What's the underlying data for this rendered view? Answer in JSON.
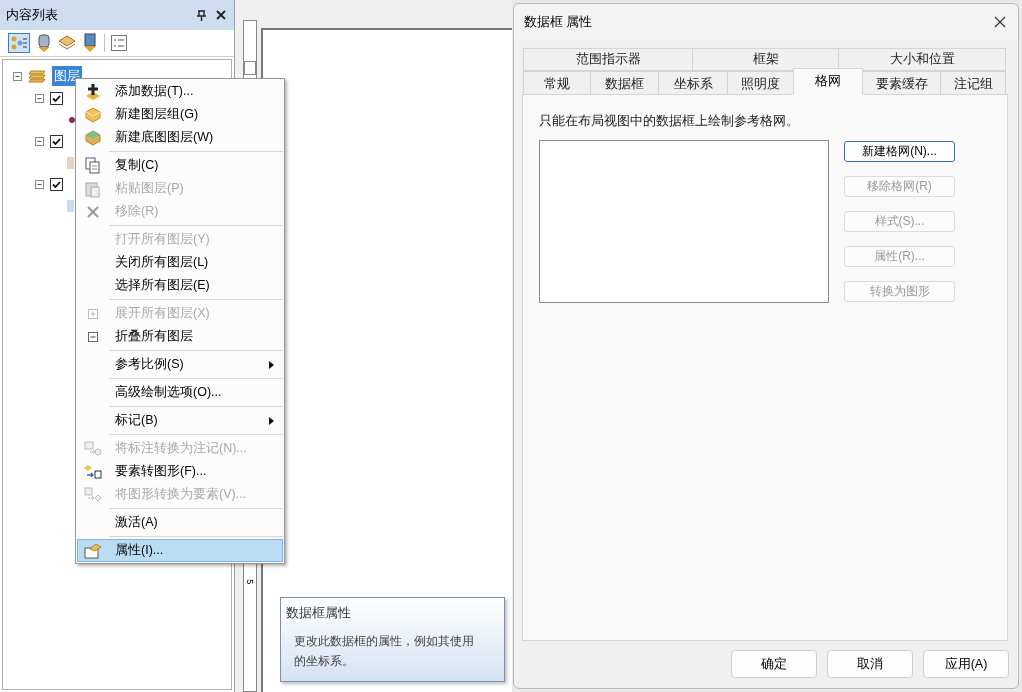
{
  "toc": {
    "title": "内容列表",
    "root": {
      "label": "图层",
      "selected": true,
      "expanded": true
    },
    "layers": [
      {
        "checked": true,
        "expanded": true,
        "color": "#8b2d4a"
      },
      {
        "checked": true,
        "expanded": true,
        "color": "#e9cfc0"
      },
      {
        "checked": true,
        "expanded": true,
        "color": "#c6dcef"
      }
    ]
  },
  "layout_view": {
    "ruler_label": "5"
  },
  "context_menu": [
    {
      "kind": "item",
      "label": "添加数据(T)...",
      "disabled": false,
      "submenu": false,
      "highlighted": false
    },
    {
      "kind": "item",
      "label": "新建图层组(G)",
      "disabled": false,
      "submenu": false,
      "highlighted": false
    },
    {
      "kind": "item",
      "label": "新建底图图层(W)",
      "disabled": false,
      "submenu": false,
      "highlighted": false
    },
    {
      "kind": "separator"
    },
    {
      "kind": "item",
      "label": "复制(C)",
      "disabled": false,
      "submenu": false,
      "highlighted": false
    },
    {
      "kind": "item",
      "label": "粘贴图层(P)",
      "disabled": true,
      "submenu": false,
      "highlighted": false
    },
    {
      "kind": "item",
      "label": "移除(R)",
      "disabled": true,
      "submenu": false,
      "highlighted": false
    },
    {
      "kind": "separator"
    },
    {
      "kind": "item",
      "label": "打开所有图层(Y)",
      "disabled": true,
      "submenu": false,
      "highlighted": false
    },
    {
      "kind": "item",
      "label": "关闭所有图层(L)",
      "disabled": false,
      "submenu": false,
      "highlighted": false
    },
    {
      "kind": "item",
      "label": "选择所有图层(E)",
      "disabled": false,
      "submenu": false,
      "highlighted": false
    },
    {
      "kind": "separator"
    },
    {
      "kind": "item",
      "label": "展开所有图层(X)",
      "disabled": true,
      "submenu": false,
      "highlighted": false
    },
    {
      "kind": "item",
      "label": "折叠所有图层",
      "disabled": false,
      "submenu": false,
      "highlighted": false
    },
    {
      "kind": "separator"
    },
    {
      "kind": "item",
      "label": "参考比例(S)",
      "disabled": false,
      "submenu": true,
      "highlighted": false
    },
    {
      "kind": "separator"
    },
    {
      "kind": "item",
      "label": "高级绘制选项(O)...",
      "disabled": false,
      "submenu": false,
      "highlighted": false
    },
    {
      "kind": "separator"
    },
    {
      "kind": "item",
      "label": "标记(B)",
      "disabled": false,
      "submenu": true,
      "highlighted": false
    },
    {
      "kind": "separator"
    },
    {
      "kind": "item",
      "label": "将标注转换为注记(N)...",
      "disabled": true,
      "submenu": false,
      "highlighted": false
    },
    {
      "kind": "item",
      "label": "要素转图形(F)...",
      "disabled": false,
      "submenu": false,
      "highlighted": false
    },
    {
      "kind": "item",
      "label": "将图形转换为要素(V)...",
      "disabled": true,
      "submenu": false,
      "highlighted": false
    },
    {
      "kind": "separator"
    },
    {
      "kind": "item",
      "label": "激活(A)",
      "disabled": false,
      "submenu": false,
      "highlighted": false
    },
    {
      "kind": "separator"
    },
    {
      "kind": "item",
      "label": "属性(I)...",
      "disabled": false,
      "submenu": false,
      "highlighted": true
    }
  ],
  "tooltip": {
    "title": "数据框属性",
    "text": "更改此数据框的属性，例如其使用的坐标系。"
  },
  "dialog": {
    "title": "数据框 属性",
    "tab_rows": [
      [
        {
          "label": "范围指示器",
          "selected": false
        },
        {
          "label": "框架",
          "selected": false
        },
        {
          "label": "大小和位置",
          "selected": false
        }
      ],
      [
        {
          "label": "常规",
          "selected": false
        },
        {
          "label": "数据框",
          "selected": false
        },
        {
          "label": "坐标系",
          "selected": false
        },
        {
          "label": "照明度",
          "selected": false
        },
        {
          "label": "格网",
          "selected": true
        },
        {
          "label": "要素缓存",
          "selected": false
        },
        {
          "label": "注记组",
          "selected": false
        }
      ]
    ],
    "note": "只能在布局视图中的数据框上绘制参考格网。",
    "grid_buttons": [
      {
        "label": "新建格网(N)...",
        "disabled": false,
        "default": true
      },
      {
        "label": "移除格网(R)",
        "disabled": true,
        "default": false
      },
      {
        "label": "样式(S)...",
        "disabled": true,
        "default": false
      },
      {
        "label": "属性(R)...",
        "disabled": true,
        "default": false
      },
      {
        "label": "转换为图形",
        "disabled": true,
        "default": false
      }
    ],
    "footer_buttons": [
      "确定",
      "取消",
      "应用(A)"
    ]
  }
}
